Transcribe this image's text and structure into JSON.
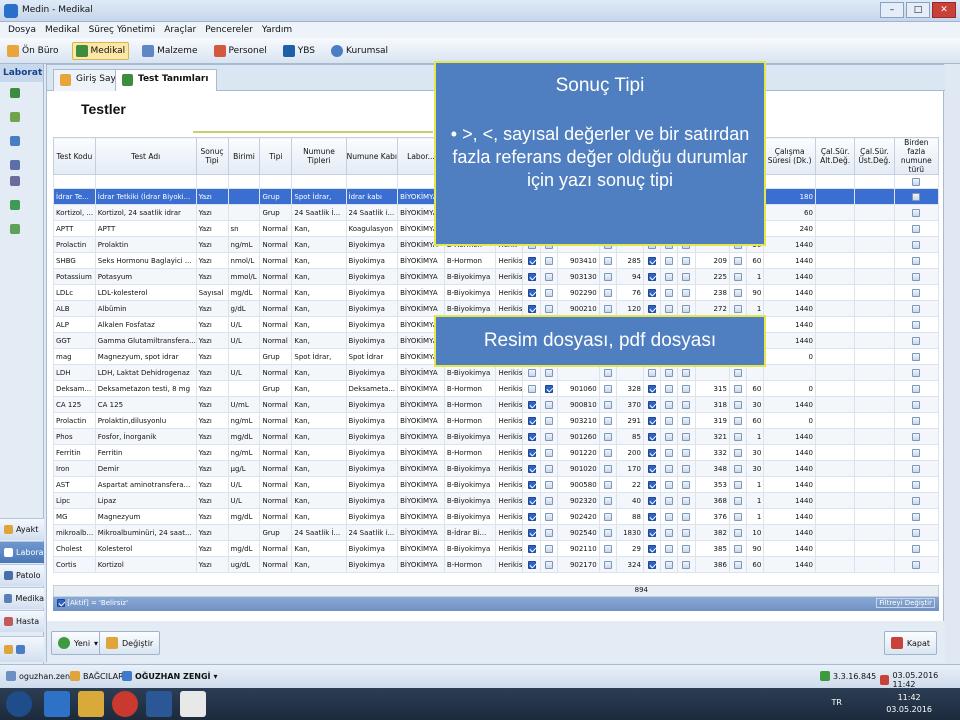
{
  "window": {
    "title": "Medin - Medikal"
  },
  "menu": [
    "Dosya",
    "Medikal",
    "Süreç Yönetimi",
    "Araçlar",
    "Pencereler",
    "Yardım"
  ],
  "modules": [
    "Ön Büro",
    "Medikal",
    "Malzeme",
    "Personel",
    "YBS",
    "Kurumsal"
  ],
  "sidebar": {
    "header": "Laboratu",
    "nav": [
      "Ayakt",
      "Labora",
      "Patolo",
      "Medika",
      "Hasta"
    ]
  },
  "tabs": [
    "Giriş Sayfası",
    "Test Tanımları"
  ],
  "page": {
    "title": "Testler"
  },
  "table": {
    "columns": [
      "Test Kodu",
      "Test Adı",
      "Sonuç Tipi",
      "Birimi",
      "Tipi",
      "Numune Tipleri",
      "Numune Kabı",
      "Labor...",
      "Test Grubu",
      "Cin",
      "",
      "",
      "",
      "",
      "",
      "",
      "",
      "",
      "",
      "",
      "k",
      "Çalışma Süresi (Dk.)",
      "Çal.Sür. Alt.Değ.",
      "Çal.Sür. Üst.Değ.",
      "Birden fazla numune türü"
    ],
    "rows": [
      [
        "İdrar Te...",
        "İdrar Tetkiki (İdrar Biyoki...",
        "Yazı",
        "",
        "Grup",
        "Spot İdrar,",
        "İdrar kabı",
        "BİYOKİMYA",
        "B-İdrar",
        "Herik",
        "",
        "",
        "",
        "",
        "",
        "",
        "",
        "",
        "",
        "",
        "1",
        "180",
        "",
        "",
        ""
      ],
      [
        "Kortizol, ...",
        "Kortizol, 24 saatlik idrar",
        "Yazı",
        "",
        "Grup",
        "24 Saatlik İ...",
        "24 Saatlik i...",
        "BİYOKİMYA",
        "B-Hormon",
        "Herik",
        "",
        "",
        "",
        "",
        "",
        "",
        "",
        "",
        "",
        "",
        "60",
        "60",
        "",
        "",
        ""
      ],
      [
        "APTT",
        "APTT",
        "Yazı",
        "sn",
        "Normal",
        "Kan,",
        "Koagulasyon",
        "BİYOKİMYA",
        "B-Koagula...",
        "Herik",
        "",
        "",
        "",
        "",
        "",
        "",
        "",
        "",
        "",
        "",
        "5",
        "240",
        "",
        "",
        ""
      ],
      [
        "Prolactin",
        "Prolaktin",
        "Yazı",
        "ng/mL",
        "Normal",
        "Kan,",
        "Biyokimya",
        "BİYOKİMYA",
        "B-Hormon",
        "Herik",
        "",
        "",
        "",
        "",
        "",
        "",
        "",
        "",
        "",
        "",
        "30",
        "1440",
        "",
        "",
        ""
      ],
      [
        "SHBG",
        "Seks Hormonu Baglayici ...",
        "Yazı",
        "nmol/L",
        "Normal",
        "Kan,",
        "Biyokimya",
        "BİYOKİMYA",
        "B-Hormon",
        "Herikisi",
        "",
        "",
        "903410",
        "",
        "285",
        "",
        "",
        "",
        "209",
        "",
        "60",
        "1440",
        "",
        "",
        ""
      ],
      [
        "Potassium",
        "Potasyum",
        "Yazı",
        "mmol/L",
        "Normal",
        "Kan,",
        "Biyokimya",
        "BİYOKİMYA",
        "B-Biyokimya",
        "Herikisi",
        "",
        "",
        "903130",
        "",
        "94",
        "",
        "",
        "",
        "225",
        "",
        "1",
        "1440",
        "",
        "",
        ""
      ],
      [
        "LDLc",
        "LDL-kolesterol",
        "Sayısal",
        "mg/dL",
        "Normal",
        "Kan,",
        "Biyokimya",
        "BİYOKİMYA",
        "B-Biyokimya",
        "Herikisi",
        "",
        "",
        "902290",
        "",
        "76",
        "",
        "",
        "",
        "238",
        "",
        "90",
        "1440",
        "",
        "",
        ""
      ],
      [
        "ALB",
        "Albümin",
        "Yazı",
        "g/dL",
        "Normal",
        "Kan,",
        "Biyokimya",
        "BİYOKİMYA",
        "B-Biyokimya",
        "Herikisi",
        "",
        "",
        "900210",
        "",
        "120",
        "",
        "",
        "",
        "272",
        "",
        "1",
        "1440",
        "",
        "",
        ""
      ],
      [
        "ALP",
        "Alkalen Fosfataz",
        "Yazı",
        "U/L",
        "Normal",
        "Kan,",
        "Biyokimya",
        "BİYOKİMYA",
        "B-Biyokimya",
        "Herikisi",
        "",
        "",
        "",
        "",
        "",
        "",
        "",
        "",
        "",
        "",
        "1",
        "1440",
        "",
        "",
        ""
      ],
      [
        "GGT",
        "Gamma Glutamiltransfera...",
        "Yazı",
        "U/L",
        "Normal",
        "Kan,",
        "Biyokimya",
        "BİYOKİMYA",
        "B-Biyokimya",
        "Herikisi",
        "",
        "",
        "",
        "",
        "",
        "",
        "",
        "",
        "",
        "",
        "1",
        "1440",
        "",
        "",
        ""
      ],
      [
        "mag",
        "Magnezyum, spot idrar",
        "Yazı",
        "",
        "Grup",
        "Spot İdrar,",
        "Spot İdrar",
        "BİYOKİMYA",
        "B-İdrar Bi...",
        "Herikisi",
        "",
        "",
        "",
        "",
        "",
        "",
        "",
        "",
        "",
        "",
        "00",
        "0",
        "",
        "",
        ""
      ],
      [
        "LDH",
        "LDH, Laktat Dehidrogenaz",
        "Yazı",
        "U/L",
        "Normal",
        "Kan,",
        "Biyokimya",
        "BİYOKİMYA",
        "B-Biyokimya",
        "Herikisi",
        "",
        "",
        "",
        "",
        "",
        "",
        "",
        "",
        "",
        "",
        "",
        "",
        "",
        "",
        ""
      ],
      [
        "Deksam...",
        "Deksametazon testi, 8 mg",
        "Yazı",
        "",
        "Grup",
        "Kan,",
        "Deksameta...",
        "BİYOKİMYA",
        "B-Hormon",
        "Herikisi",
        "",
        "",
        "901060",
        "",
        "328",
        "",
        "",
        "",
        "315",
        "",
        "60",
        "0",
        "",
        "",
        ""
      ],
      [
        "CA 125",
        "CA 125",
        "Yazı",
        "U/mL",
        "Normal",
        "Kan,",
        "Biyokimya",
        "BİYOKİMYA",
        "B-Hormon",
        "Herikisi",
        "",
        "",
        "900810",
        "",
        "370",
        "",
        "",
        "",
        "318",
        "",
        "30",
        "1440",
        "",
        "",
        ""
      ],
      [
        "Prolactin",
        "Prolaktin,dilusyonlu",
        "Yazı",
        "ng/mL",
        "Normal",
        "Kan,",
        "Biyokimya",
        "BİYOKİMYA",
        "B-Hormon",
        "Herikisi",
        "",
        "",
        "903210",
        "",
        "291",
        "",
        "",
        "",
        "319",
        "",
        "60",
        "0",
        "",
        "",
        ""
      ],
      [
        "Phos",
        "Fosfor, İnorganik",
        "Yazı",
        "mg/dL",
        "Normal",
        "Kan,",
        "Biyokimya",
        "BİYOKİMYA",
        "B-Biyokimya",
        "Herikisi",
        "",
        "",
        "901260",
        "",
        "85",
        "",
        "",
        "",
        "321",
        "",
        "1",
        "1440",
        "",
        "",
        ""
      ],
      [
        "Ferritin",
        "Ferritin",
        "Yazı",
        "ng/mL",
        "Normal",
        "Kan,",
        "Biyokimya",
        "BİYOKİMYA",
        "B-Hormon",
        "Herikisi",
        "",
        "",
        "901220",
        "",
        "200",
        "",
        "",
        "",
        "332",
        "",
        "30",
        "1440",
        "",
        "",
        ""
      ],
      [
        "Iron",
        "Demir",
        "Yazı",
        "µg/L",
        "Normal",
        "Kan,",
        "Biyokimya",
        "BİYOKİMYA",
        "B-Biyokimya",
        "Herikisi",
        "",
        "",
        "901020",
        "",
        "170",
        "",
        "",
        "",
        "348",
        "",
        "30",
        "1440",
        "",
        "",
        ""
      ],
      [
        "AST",
        "Aspartat aminotransfera...",
        "Yazı",
        "U/L",
        "Normal",
        "Kan,",
        "Biyokimya",
        "BİYOKİMYA",
        "B-Biyokimya",
        "Herikisi",
        "",
        "",
        "900580",
        "",
        "22",
        "",
        "",
        "",
        "353",
        "",
        "1",
        "1440",
        "",
        "",
        ""
      ],
      [
        "Lipc",
        "Lipaz",
        "Yazı",
        "U/L",
        "Normal",
        "Kan,",
        "Biyokimya",
        "BİYOKİMYA",
        "B-Biyokimya",
        "Herikisi",
        "",
        "",
        "902320",
        "",
        "40",
        "",
        "",
        "",
        "368",
        "",
        "1",
        "1440",
        "",
        "",
        ""
      ],
      [
        "MG",
        "Magnezyum",
        "Yazı",
        "mg/dL",
        "Normal",
        "Kan,",
        "Biyokimya",
        "BİYOKİMYA",
        "B-Biyokimya",
        "Herikisi",
        "",
        "",
        "902420",
        "",
        "88",
        "",
        "",
        "",
        "376",
        "",
        "1",
        "1440",
        "",
        "",
        ""
      ],
      [
        "mikroalb...",
        "Mikroalbuminüri, 24 saat...",
        "Yazı",
        "",
        "Grup",
        "24 Saatlik İ...",
        "24 Saatlik i...",
        "BİYOKİMYA",
        "B-İdrar Bi...",
        "Herikisi",
        "",
        "",
        "902540",
        "",
        "1830",
        "",
        "",
        "",
        "382",
        "",
        "10",
        "1440",
        "",
        "",
        ""
      ],
      [
        "Cholest",
        "Kolesterol",
        "Yazı",
        "mg/dL",
        "Normal",
        "Kan,",
        "Biyokimya",
        "BİYOKİMYA",
        "B-Biyokimya",
        "Herikisi",
        "",
        "",
        "902110",
        "",
        "29",
        "",
        "",
        "",
        "385",
        "",
        "90",
        "1440",
        "",
        "",
        ""
      ],
      [
        "Cortis",
        "Kortizol",
        "Yazı",
        "ug/dL",
        "Normal",
        "Kan,",
        "Biyokimya",
        "BİYOKİMYA",
        "B-Hormon",
        "Herikisi",
        "",
        "",
        "902170",
        "",
        "324",
        "",
        "",
        "",
        "386",
        "",
        "60",
        "1440",
        "",
        "",
        ""
      ]
    ],
    "count": "894",
    "filter_text": "[Aktif] = 'Belirsiz'",
    "filter_button": "Filtreyi Değiştir"
  },
  "buttons": {
    "new": "Yeni",
    "edit": "Değiştir",
    "close": "Kapat"
  },
  "status": {
    "user": "oguzhan.zengi",
    "location": "BAĞCILAR",
    "name": "OĞUZHAN ZENGİ",
    "version": "3.3.16.845",
    "date": "03.05.2016 11:42"
  },
  "taskbar": {
    "lang": "TR",
    "time": "11:42",
    "date": "03.05.2016"
  },
  "overlay": {
    "title": "Sonuç Tipi",
    "bullet": "• >, <, sayısal değerler ve bir satırdan fazla referans değer olduğu durumlar için yazı sonuç tipi",
    "second": "Resim dosyası, pdf dosyası"
  }
}
